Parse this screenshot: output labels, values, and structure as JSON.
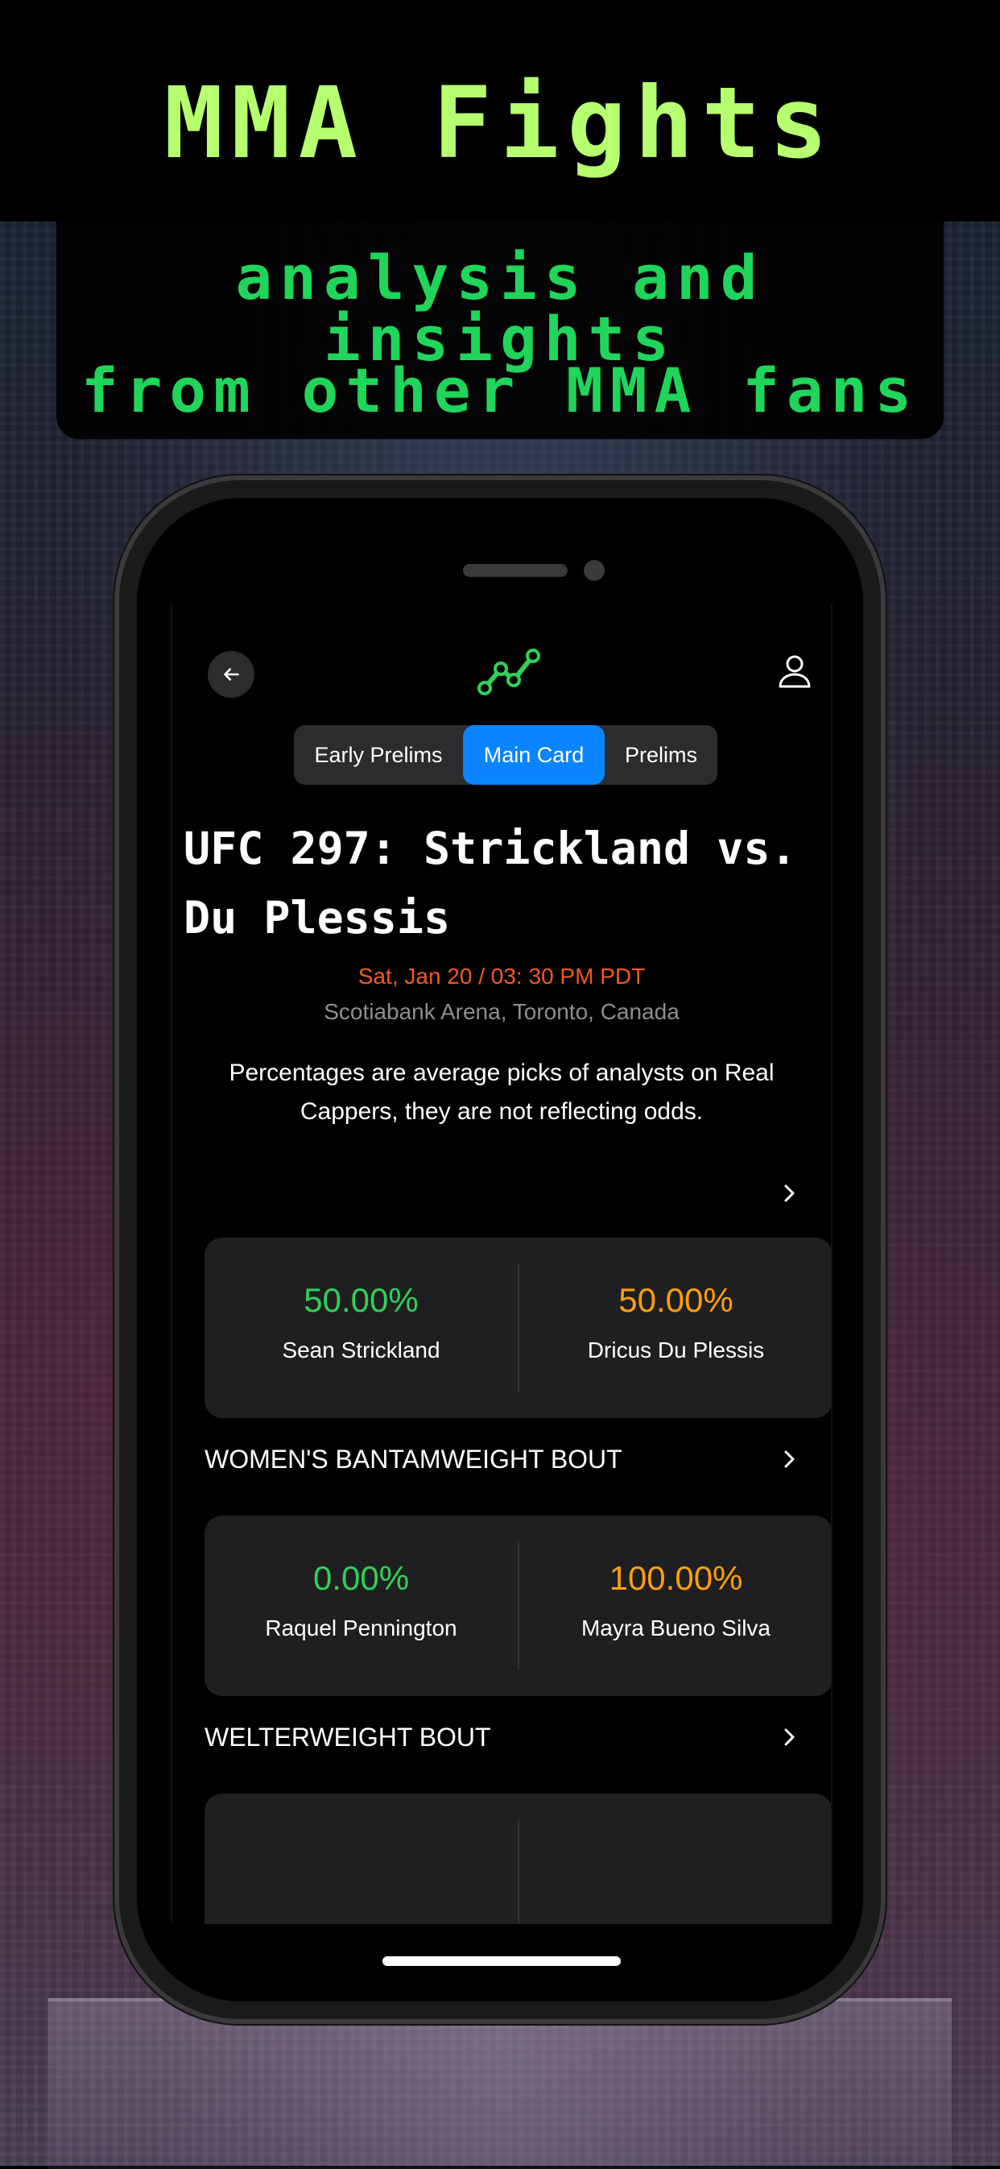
{
  "promo": {
    "title": "MMA Fights",
    "tagline_line1": "analysis and insights",
    "tagline_line2": "from other MMA fans"
  },
  "colors": {
    "title": "#b6ff6e",
    "tagline": "#1fd65a",
    "accent_blue": "#0a84ff",
    "date_orange": "#ef5a24",
    "pct_green": "#2fd158",
    "pct_orange": "#ff9f0a"
  },
  "nav": {
    "back_icon": "arrow-left-icon",
    "logo_icon": "trend-line-icon",
    "profile_icon": "user-icon"
  },
  "tabs": [
    {
      "label": "Early Prelims",
      "active": false
    },
    {
      "label": "Main Card",
      "active": true
    },
    {
      "label": "Prelims",
      "active": false
    }
  ],
  "event": {
    "title": "UFC 297: Strickland vs. Du Plessis",
    "date": "Sat, Jan 20 / 03: 30 PM PDT",
    "venue": "Scotiabank Arena, Toronto, Canada",
    "disclaimer": "Percentages are average picks of analysts on Real Cappers, they are not reflecting odds."
  },
  "bouts": [
    {
      "label": "",
      "fighter_a": {
        "name": "Sean Strickland",
        "pct": "50.00%"
      },
      "fighter_b": {
        "name": "Dricus Du Plessis",
        "pct": "50.00%"
      }
    },
    {
      "label": "WOMEN'S BANTAMWEIGHT BOUT",
      "fighter_a": {
        "name": "Raquel Pennington",
        "pct": "0.00%"
      },
      "fighter_b": {
        "name": "Mayra Bueno Silva",
        "pct": "100.00%"
      }
    },
    {
      "label": "WELTERWEIGHT BOUT"
    }
  ]
}
